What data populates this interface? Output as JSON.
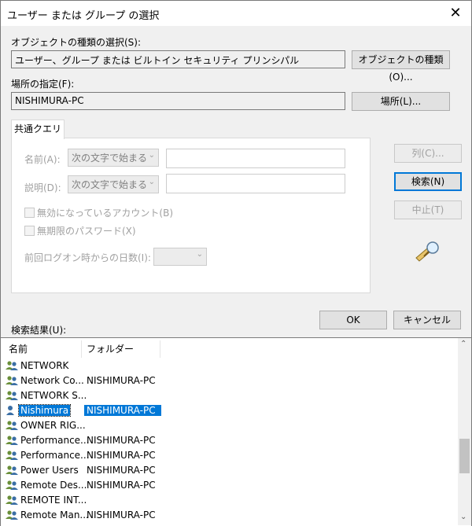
{
  "window": {
    "title": "ユーザー または グループ の選択",
    "close_symbol": "✕"
  },
  "object_type": {
    "label": "オブジェクトの種類の選択(S):",
    "value": "ユーザー、グループ または ビルトイン セキュリティ プリンシパル",
    "button": "オブジェクトの種類(O)..."
  },
  "location": {
    "label": "場所の指定(F):",
    "value": "NISHIMURA-PC",
    "button": "場所(L)..."
  },
  "query": {
    "tab_label": "共通クエリ",
    "name_label": "名前(A):",
    "name_mode": "次の文字で始まる",
    "desc_label": "説明(D):",
    "desc_mode": "次の文字で始まる",
    "disabled_accounts": "無効になっているアカウント(B)",
    "non_expiring_pw": "無期限のパスワード(X)",
    "days_since_logon": "前回ログオン時からの日数(I):"
  },
  "buttons": {
    "columns": "列(C)...",
    "search": "検索(N)",
    "stop": "中止(T)",
    "ok": "OK",
    "cancel": "キャンセル"
  },
  "results": {
    "label": "検索結果(U):",
    "col_name": "名前",
    "col_folder": "フォルダー",
    "rows": [
      {
        "name": "NETWORK",
        "folder": ""
      },
      {
        "name": "Network Co...",
        "folder": "NISHIMURA-PC"
      },
      {
        "name": "NETWORK S...",
        "folder": ""
      },
      {
        "name": "Nishimura",
        "folder": "NISHIMURA-PC",
        "selected": true
      },
      {
        "name": "OWNER RIG...",
        "folder": ""
      },
      {
        "name": "Performance...",
        "folder": "NISHIMURA-PC"
      },
      {
        "name": "Performance...",
        "folder": "NISHIMURA-PC"
      },
      {
        "name": "Power Users",
        "folder": "NISHIMURA-PC"
      },
      {
        "name": "Remote Des...",
        "folder": "NISHIMURA-PC"
      },
      {
        "name": "REMOTE INT...",
        "folder": ""
      },
      {
        "name": "Remote Man...",
        "folder": "NISHIMURA-PC"
      }
    ]
  },
  "colors": {
    "accent": "#0078d7",
    "dialog_bg": "#f0f0f0"
  }
}
